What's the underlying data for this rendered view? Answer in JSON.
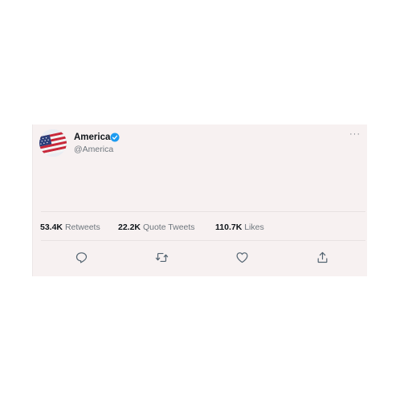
{
  "tweet": {
    "author": {
      "display_name": "America",
      "handle": "@America",
      "verified": true,
      "avatar_icon": "us-flag-icon"
    },
    "more_label": "···",
    "stats": [
      {
        "value": "53.4K",
        "label": " Retweets"
      },
      {
        "value": "22.2K",
        "label": " Quote Tweets"
      },
      {
        "value": "110.7K",
        "label": " Likes"
      }
    ],
    "actions": [
      "reply-icon",
      "retweet-icon",
      "like-icon",
      "share-icon"
    ],
    "colors": {
      "card_background": "#f7f1f1",
      "verified_blue": "#1d9bf0",
      "secondary_text": "#6e767d",
      "primary_text": "#0f1419"
    }
  }
}
